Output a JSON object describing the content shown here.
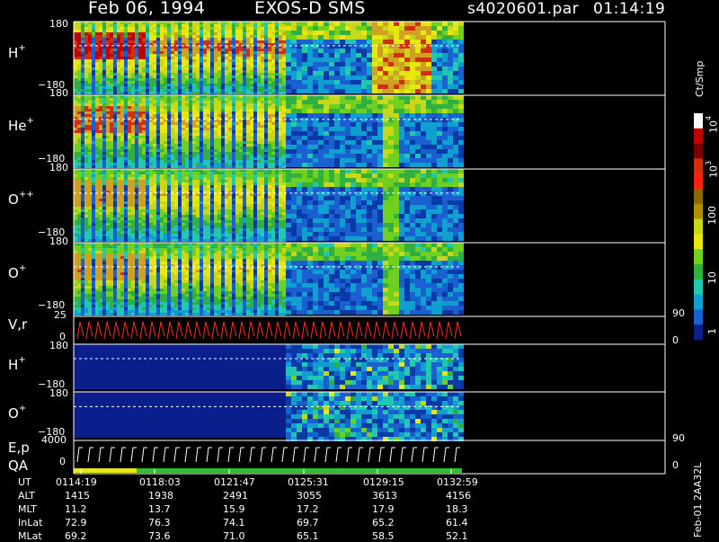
{
  "header": {
    "date": "Feb 06, 1994",
    "instrument": "EXOS-D SMS",
    "file": "s4020601.par",
    "time": "01:14:19"
  },
  "panels": [
    {
      "label": "H",
      "sup": "+",
      "ytop": "180",
      "ybot": "−180"
    },
    {
      "label": "He",
      "sup": "+",
      "ytop": "180",
      "ybot": "−180"
    },
    {
      "label": "O",
      "sup": "++",
      "ytop": "180",
      "ybot": "−180"
    },
    {
      "label": "O",
      "sup": "+",
      "ytop": "180",
      "ybot": "−180"
    },
    {
      "label": "V,r",
      "ytop": "25",
      "ybot": "0",
      "rtop": "90",
      "rbot": "0"
    },
    {
      "label": "H",
      "sup": "+",
      "ytop": "180",
      "ybot": "−180"
    },
    {
      "label": "O",
      "sup": "+",
      "ytop": "180",
      "ybot": "−180"
    },
    {
      "label": "E,p",
      "label2": "QA",
      "ytop": "4000",
      "ybot": "0",
      "rtop": "90",
      "rbot": "0"
    }
  ],
  "colorbar": {
    "title": "Ct/Smp",
    "ticks": [
      "10^4",
      "10^3",
      "100",
      "10",
      "1"
    ]
  },
  "footer": {
    "right_label": "Feb-01 2AA32L",
    "rows": [
      {
        "name": "UT",
        "values": [
          "0114:19",
          "0118:03",
          "0121:47",
          "0125:31",
          "0129:15",
          "0132:59"
        ]
      },
      {
        "name": "ALT",
        "values": [
          "1415",
          "1938",
          "2491",
          "3055",
          "3613",
          "4156"
        ]
      },
      {
        "name": "MLT",
        "values": [
          "11.2",
          "13.7",
          "15.9",
          "17.2",
          "17.9",
          "18.3"
        ]
      },
      {
        "name": "InLat",
        "values": [
          "72.9",
          "76.3",
          "74.1",
          "69.7",
          "65.2",
          "61.4"
        ]
      },
      {
        "name": "MLat",
        "values": [
          "69.2",
          "73.6",
          "71.0",
          "65.1",
          "58.5",
          "52.1"
        ]
      }
    ]
  },
  "chart_data": {
    "type": "heatmap",
    "title": "Feb 06, 1994   EXOS-D SMS",
    "x_ticks_ut": [
      "0114:19",
      "0118:03",
      "0121:47",
      "0125:31",
      "0129:15",
      "0132:59"
    ],
    "panels": [
      "H+",
      "He+",
      "O++",
      "O+",
      "V,r",
      "H+",
      "O+",
      "E,p / QA"
    ],
    "y_range_angle": [
      -180,
      180
    ],
    "colorbar_unit": "Ct/Smp",
    "colorbar_scale": "log",
    "colorbar_range": [
      1,
      10000
    ],
    "colors": {
      "background": "#000000",
      "low": "#0a1e8c",
      "high": "#cc0000",
      "line_trace": "#ff3020"
    }
  }
}
